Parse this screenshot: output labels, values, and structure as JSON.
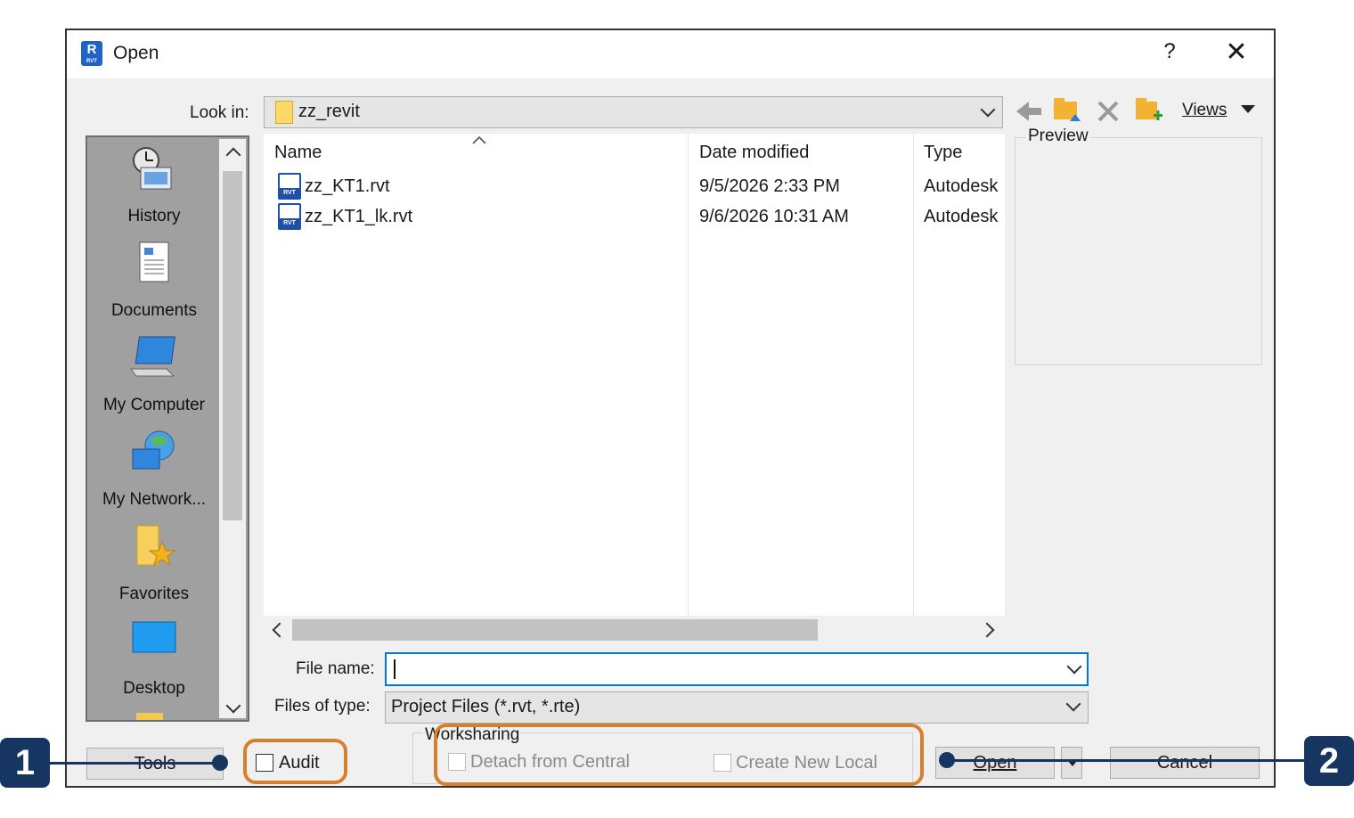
{
  "dialog": {
    "title": "Open",
    "help": "?",
    "close": "✕"
  },
  "look_in": {
    "label": "Look in:",
    "value": "zz_revit"
  },
  "toolbar": {
    "views": "Views",
    "icons": [
      "back-arrow-icon",
      "up-folder-icon",
      "delete-icon",
      "new-folder-icon",
      "views-dropdown-icon"
    ]
  },
  "places": [
    {
      "label": "History",
      "icon": "history-icon"
    },
    {
      "label": "Documents",
      "icon": "documents-icon"
    },
    {
      "label": "My Computer",
      "icon": "my-computer-icon"
    },
    {
      "label": "My Network...",
      "icon": "my-network-icon"
    },
    {
      "label": "Favorites",
      "icon": "favorites-icon"
    },
    {
      "label": "Desktop",
      "icon": "desktop-icon"
    }
  ],
  "file_list": {
    "columns": [
      "Name",
      "Date modified",
      "Type"
    ],
    "rows": [
      {
        "name": "zz_KT1.rvt",
        "date": "9/5/2026 2:33 PM",
        "type": "Autodesk"
      },
      {
        "name": "zz_KT1_lk.rvt",
        "date": "9/6/2026 10:31 AM",
        "type": "Autodesk"
      }
    ]
  },
  "preview": {
    "label": "Preview"
  },
  "file_name": {
    "label": "File name:",
    "value": ""
  },
  "file_type": {
    "label": "Files of type:",
    "value": "Project Files (*.rvt, *.rte)"
  },
  "bottom": {
    "tools": "Tools",
    "audit": "Audit",
    "worksharing": "Worksharing",
    "detach": "Detach from Central",
    "create_local": "Create New Local",
    "open": "Open",
    "cancel": "Cancel"
  },
  "callouts": {
    "one": "1",
    "two": "2"
  },
  "colors": {
    "highlight": "#d67f2c",
    "callout_badge": "#163561",
    "focus_border": "#0078d7"
  }
}
